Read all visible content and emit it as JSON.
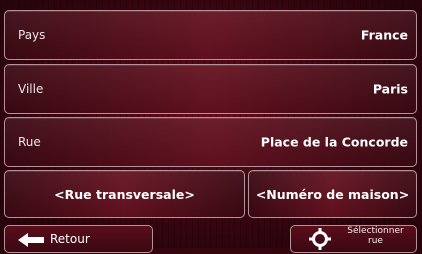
{
  "fields": [
    {
      "label": "Pays",
      "value": "France"
    },
    {
      "label": "Ville",
      "value": "Paris"
    },
    {
      "label": "Rue",
      "value": "Place de la Concorde"
    }
  ],
  "actions": {
    "cross_street_label": "<Rue transversale>",
    "house_number_label": "<Numéro de maison>"
  },
  "footer": {
    "back_label": "Retour",
    "select_street_line1": "Sélectionner",
    "select_street_line2": "rue"
  },
  "icons": {
    "back": "arrow-left-icon",
    "select": "crosshair-target-icon"
  },
  "colors": {
    "background": "#3e0611",
    "border": "#b7919a",
    "text": "#ffffff"
  }
}
